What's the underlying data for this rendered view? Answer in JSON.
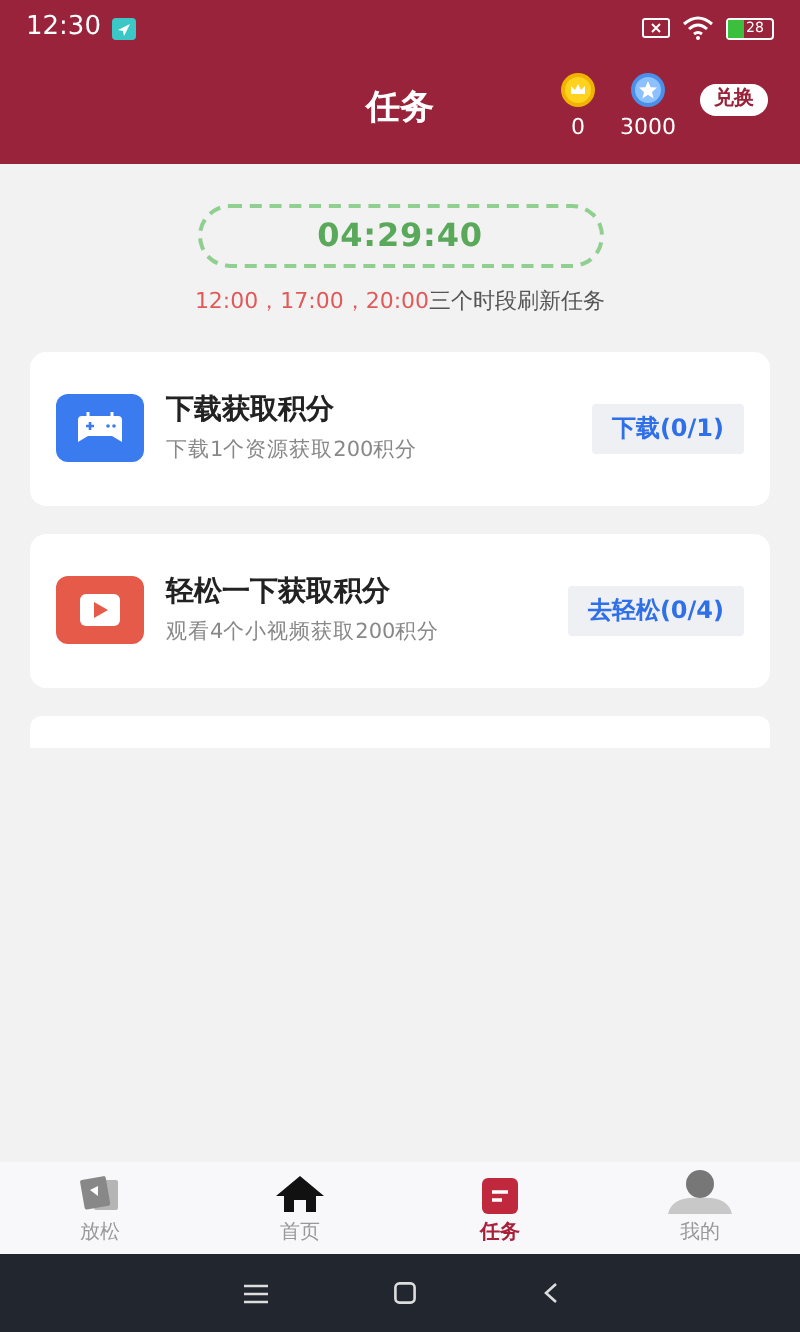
{
  "status_bar": {
    "time": "12:30",
    "battery": "28"
  },
  "header": {
    "title": "任务",
    "balances": [
      {
        "kind": "gold",
        "value": "0"
      },
      {
        "kind": "silver",
        "value": "3000"
      }
    ],
    "exchange_button": "兑换"
  },
  "countdown": {
    "time": "04:29:40",
    "slots": "12:00，17:00，20:00",
    "note": "三个时段刷新任务"
  },
  "tasks": [
    {
      "kind": "game",
      "title": "下载获取积分",
      "subtitle": "下载1个资源获取200积分",
      "action": "下载(0/1)"
    },
    {
      "kind": "video",
      "title": "轻松一下获取积分",
      "subtitle": "观看4个小视频获取200积分",
      "action": "去轻松(0/4)"
    }
  ],
  "tab_bar": [
    {
      "kind": "relax",
      "label": "放松",
      "selected": false
    },
    {
      "kind": "home",
      "label": "首页",
      "selected": false
    },
    {
      "kind": "tasks",
      "label": "任务",
      "selected": true
    },
    {
      "kind": "me",
      "label": "我的",
      "selected": false
    }
  ]
}
